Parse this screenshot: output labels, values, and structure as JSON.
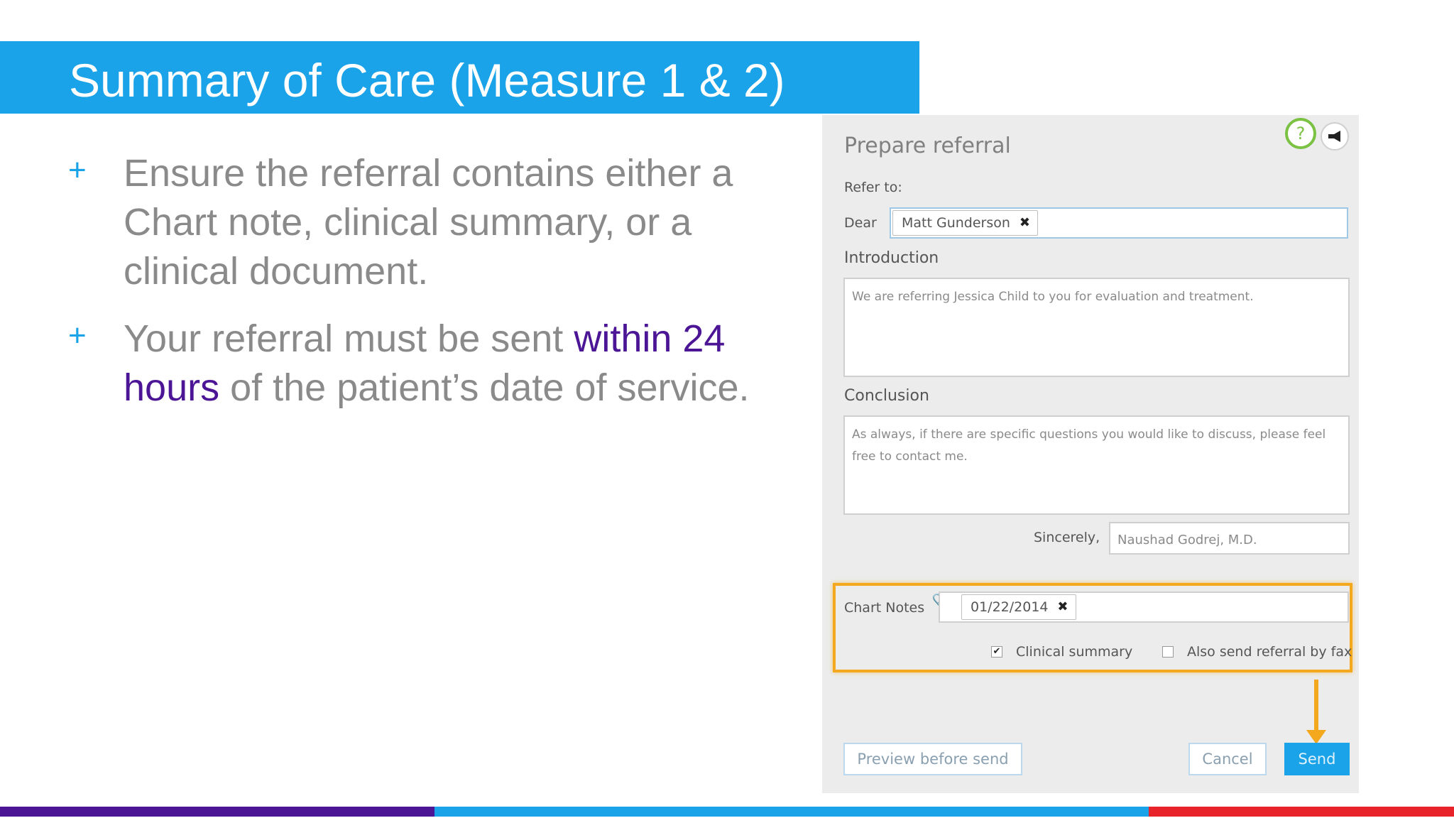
{
  "slide": {
    "title": "Summary of Care (Measure 1 & 2)",
    "bullets": [
      {
        "marker": "+",
        "text": "Ensure the referral contains either a Chart note, clinical summary, or a clinical document."
      },
      {
        "marker": "+",
        "pre": "Your referral must be sent ",
        "highlight": "within 24 hours",
        "post": " of the patient’s date of service."
      }
    ]
  },
  "colors": {
    "title_bar": "#1aa3e8",
    "highlight_text": "#4b1595",
    "bullet_text": "#8a8a8a",
    "callout_orange": "#f3a81e",
    "bottom_bar": [
      "#4b1595",
      "#1aa3e8",
      "#e8242a"
    ]
  },
  "referral": {
    "title": "Prepare referral",
    "help_icon": "?",
    "announce_icon": "megaphone-icon",
    "refer_to_label": "Refer to:",
    "dear_label": "Dear",
    "recipient": "Matt Gunderson",
    "introduction_label": "Introduction",
    "introduction_text": "We are referring Jessica Child to you for evaluation and treatment.",
    "conclusion_label": "Conclusion",
    "conclusion_text": "As always, if there are specific questions you would like to discuss, please feel free to contact me.",
    "sincerely_label": "Sincerely,",
    "sincerely_value": "Naushad Godrej, M.D.",
    "chart_notes_label": "Chart Notes",
    "chart_note_date": "01/22/2014",
    "clinical_summary_label": "Clinical summary",
    "clinical_summary_checked": true,
    "fax_label": "Also send referral by fax",
    "fax_checked": false,
    "preview_button": "Preview before send",
    "cancel_button": "Cancel",
    "send_button": "Send"
  }
}
